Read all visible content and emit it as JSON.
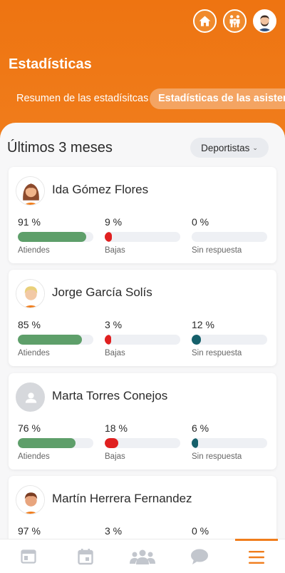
{
  "page": {
    "title": "Estadísticas"
  },
  "tabs": [
    {
      "label": "Resumen de las estadísitcas",
      "active": false
    },
    {
      "label": "Estadísticas de las asistencias",
      "active": true
    }
  ],
  "section": {
    "title": "Últimos 3 meses",
    "filter_label": "Deportistas"
  },
  "stat_labels": {
    "attend": "Atiendes",
    "absent": "Bajas",
    "no_response": "Sin respuesta"
  },
  "colors": {
    "brand": "#f07d1c",
    "attend": "#5e9f6a",
    "absent": "#e02020",
    "no_response": "#16606b",
    "track": "#eef0f4"
  },
  "athletes": [
    {
      "name": "Ida Gómez Flores",
      "avatar": "girl-avatar-icon",
      "attend": {
        "text": "91 %",
        "value": 91
      },
      "absent": {
        "text": "9 %",
        "value": 9
      },
      "no_response": {
        "text": "0 %",
        "value": 0
      }
    },
    {
      "name": "Jorge García Solís",
      "avatar": "blond-boy-avatar-icon",
      "attend": {
        "text": "85 %",
        "value": 85
      },
      "absent": {
        "text": "3 %",
        "value": 3
      },
      "no_response": {
        "text": "12 %",
        "value": 12
      }
    },
    {
      "name": "Marta Torres Conejos",
      "avatar": "default-user-icon",
      "attend": {
        "text": "76 %",
        "value": 76
      },
      "absent": {
        "text": "18 %",
        "value": 18
      },
      "no_response": {
        "text": "6 %",
        "value": 6
      }
    },
    {
      "name": "Martín Herrera Fernandez",
      "avatar": "boy-avatar-icon",
      "attend": {
        "text": "97 %",
        "value": 97
      },
      "absent": {
        "text": "3 %",
        "value": 3
      },
      "no_response": {
        "text": "0 %",
        "value": 0
      }
    }
  ],
  "bottom_nav": [
    {
      "icon": "news-icon",
      "active": false
    },
    {
      "icon": "calendar-icon",
      "active": false
    },
    {
      "icon": "team-icon",
      "active": false
    },
    {
      "icon": "chat-icon",
      "active": false
    },
    {
      "icon": "menu-icon",
      "active": true
    }
  ]
}
